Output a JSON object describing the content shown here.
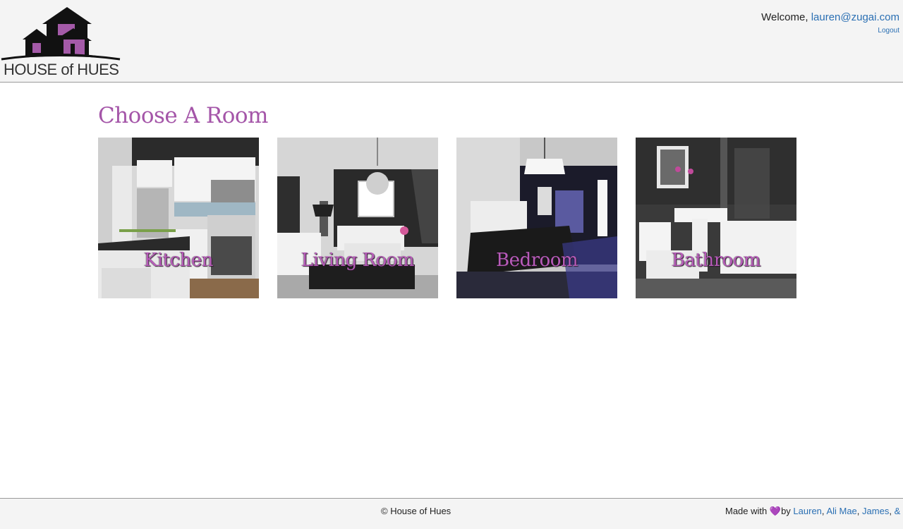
{
  "header": {
    "logo_text": "HOUSE of HUES",
    "welcome_label": "Welcome,",
    "user_email": "lauren@zugai.com",
    "logout_label": "Logout"
  },
  "main": {
    "title": "Choose A Room",
    "rooms": [
      {
        "label": "Kitchen"
      },
      {
        "label": "Living Room"
      },
      {
        "label": "Bedroom"
      },
      {
        "label": "Bathroom"
      }
    ]
  },
  "footer": {
    "copyright": "© House of Hues",
    "made_with": "Made with",
    "by": "by",
    "authors": [
      "Lauren",
      "Ali Mae",
      "James",
      "& No"
    ],
    "separator": ","
  },
  "colors": {
    "accent_purple": "#a455a8",
    "link_blue": "#2a6fb3",
    "bar_gray": "#f4f4f4"
  },
  "icons": {
    "heart": "purple-heart-icon",
    "logo": "house-logo-icon"
  }
}
